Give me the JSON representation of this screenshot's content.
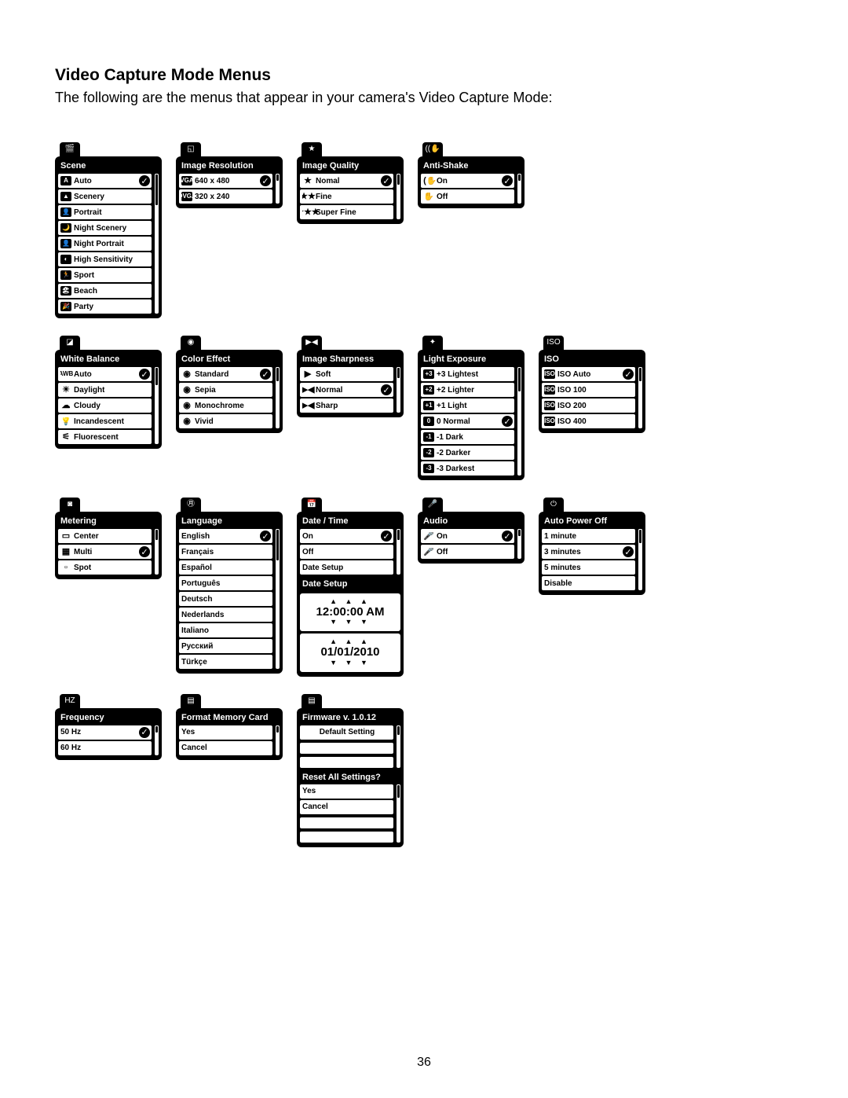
{
  "page": {
    "title": "Video Capture Mode Menus",
    "intro": "The following are the menus that appear in your camera's Video Capture Mode:",
    "number": "36"
  },
  "menus": {
    "scene": {
      "tab_icon": "🎬",
      "title": "Scene",
      "options": [
        {
          "icon": "A",
          "label": "Auto",
          "selected": true
        },
        {
          "icon": "▲",
          "label": "Scenery"
        },
        {
          "icon": "👤",
          "label": "Portrait"
        },
        {
          "icon": "🌙",
          "label": "Night Scenery"
        },
        {
          "icon": "👤",
          "label": "Night Portrait"
        },
        {
          "icon": "◐",
          "label": "High Sensitivity"
        },
        {
          "icon": "🏃",
          "label": "Sport"
        },
        {
          "icon": "🏖",
          "label": "Beach"
        },
        {
          "icon": "🎉",
          "label": "Party"
        }
      ]
    },
    "image_resolution": {
      "tab_icon": "◱",
      "title": "Image Resolution",
      "options": [
        {
          "icon": "VGA",
          "label": "640 x 480",
          "selected": true
        },
        {
          "icon": "QVGA",
          "label": "320 x 240"
        }
      ]
    },
    "image_quality": {
      "tab_icon": "★",
      "title": "Image Quality",
      "options": [
        {
          "plain_icon": "★",
          "label": "Nomal",
          "selected": true
        },
        {
          "plain_icon": "★★",
          "label": "Fine"
        },
        {
          "plain_icon": "★★★",
          "label": "Super Fine",
          "tiny": true
        }
      ]
    },
    "anti_shake": {
      "tab_icon": "((✋",
      "title": "Anti-Shake",
      "options": [
        {
          "plain_icon": "((✋",
          "label": "On",
          "selected": true
        },
        {
          "plain_icon": "✋",
          "label": "Off"
        }
      ]
    },
    "white_balance": {
      "tab_icon": "◪",
      "title": "White Balance",
      "options": [
        {
          "plain_icon": "AWB",
          "label": "Auto",
          "selected": true,
          "plaintext": true
        },
        {
          "plain_icon": "☀",
          "label": "Daylight"
        },
        {
          "plain_icon": "☁",
          "label": "Cloudy"
        },
        {
          "plain_icon": "💡",
          "label": "Incandescent"
        },
        {
          "plain_icon": "⚟",
          "label": "Fluorescent"
        }
      ]
    },
    "color_effect": {
      "tab_icon": "◉",
      "title": "Color Effect",
      "options": [
        {
          "plain_icon": "◉",
          "label": "Standard",
          "selected": true
        },
        {
          "plain_icon": "◉",
          "label": "Sepia"
        },
        {
          "plain_icon": "◉",
          "label": "Monochrome"
        },
        {
          "plain_icon": "◉",
          "label": "Vivid"
        }
      ]
    },
    "image_sharpness": {
      "tab_icon": "▶◀",
      "title": "Image Sharpness",
      "options": [
        {
          "plain_icon": "▶",
          "label": "Soft"
        },
        {
          "plain_icon": "▶◀",
          "label": "Normal",
          "selected": true
        },
        {
          "plain_icon": "▶◀",
          "label": "Sharp"
        }
      ]
    },
    "light_exposure": {
      "tab_icon": "✦",
      "title": "Light Exposure",
      "options": [
        {
          "icon": "+3",
          "label": "+3 Lightest"
        },
        {
          "icon": "+2",
          "label": "+2 Lighter"
        },
        {
          "icon": "+1",
          "label": "+1 Light"
        },
        {
          "icon": "0",
          "label": "0 Normal",
          "selected": true
        },
        {
          "icon": "-1",
          "label": "-1 Dark"
        },
        {
          "icon": "-2",
          "label": "-2 Darker"
        },
        {
          "icon": "-3",
          "label": "-3 Darkest"
        }
      ]
    },
    "iso": {
      "tab_icon": "ISO",
      "title": "ISO",
      "options": [
        {
          "icon": "ISO",
          "label": "ISO Auto",
          "selected": true
        },
        {
          "icon": "ISO",
          "label": "ISO 100"
        },
        {
          "icon": "ISO",
          "label": "ISO 200"
        },
        {
          "icon": "ISO",
          "label": "ISO 400"
        }
      ]
    },
    "metering": {
      "tab_icon": "◙",
      "title": "Metering",
      "options": [
        {
          "plain_icon": "▭",
          "label": "Center"
        },
        {
          "plain_icon": "▦",
          "label": "Multi",
          "selected": true
        },
        {
          "plain_icon": "▫",
          "label": "Spot"
        }
      ]
    },
    "language": {
      "tab_icon": "㊊",
      "title": "Language",
      "options": [
        {
          "label": "English",
          "selected": true
        },
        {
          "label": "Français"
        },
        {
          "label": "Español"
        },
        {
          "label": "Português"
        },
        {
          "label": "Deutsch"
        },
        {
          "label": "Nederlands"
        },
        {
          "label": "Italiano"
        },
        {
          "label": "Русский"
        },
        {
          "label": "Türkçe"
        }
      ]
    },
    "date_time": {
      "tab_icon": "📅",
      "title": "Date / Time",
      "options": [
        {
          "label": "On",
          "selected": true
        },
        {
          "label": "Off"
        },
        {
          "label": "Date Setup"
        }
      ],
      "date_setup_title": "Date Setup",
      "time_value": "12:00:00 AM",
      "date_value": "01/01/2010"
    },
    "audio": {
      "tab_icon": "🎤",
      "title": "Audio",
      "options": [
        {
          "plain_icon": "🎤",
          "label": "On",
          "selected": true
        },
        {
          "plain_icon": "🎤",
          "label": "Off"
        }
      ]
    },
    "auto_power_off": {
      "tab_icon": "⏻",
      "title": "Auto Power Off",
      "options": [
        {
          "label": "1 minute"
        },
        {
          "label": "3 minutes",
          "selected": true
        },
        {
          "label": "5 minutes"
        },
        {
          "label": "Disable"
        }
      ]
    },
    "frequency": {
      "tab_icon": "HZ",
      "title": "Frequency",
      "options": [
        {
          "label": "50 Hz",
          "selected": true
        },
        {
          "label": "60 Hz"
        }
      ]
    },
    "format": {
      "tab_icon": "▤",
      "title": "Format Memory Card",
      "options": [
        {
          "label": "Yes"
        },
        {
          "label": "Cancel"
        }
      ]
    },
    "firmware": {
      "tab_icon": "▤",
      "title": "Firmware v. 1.0.12",
      "options": [
        {
          "label": "Default Setting",
          "center": true
        }
      ],
      "reset_title": "Reset All Settings?",
      "reset_options": [
        {
          "label": "Yes"
        },
        {
          "label": "Cancel"
        }
      ]
    }
  }
}
